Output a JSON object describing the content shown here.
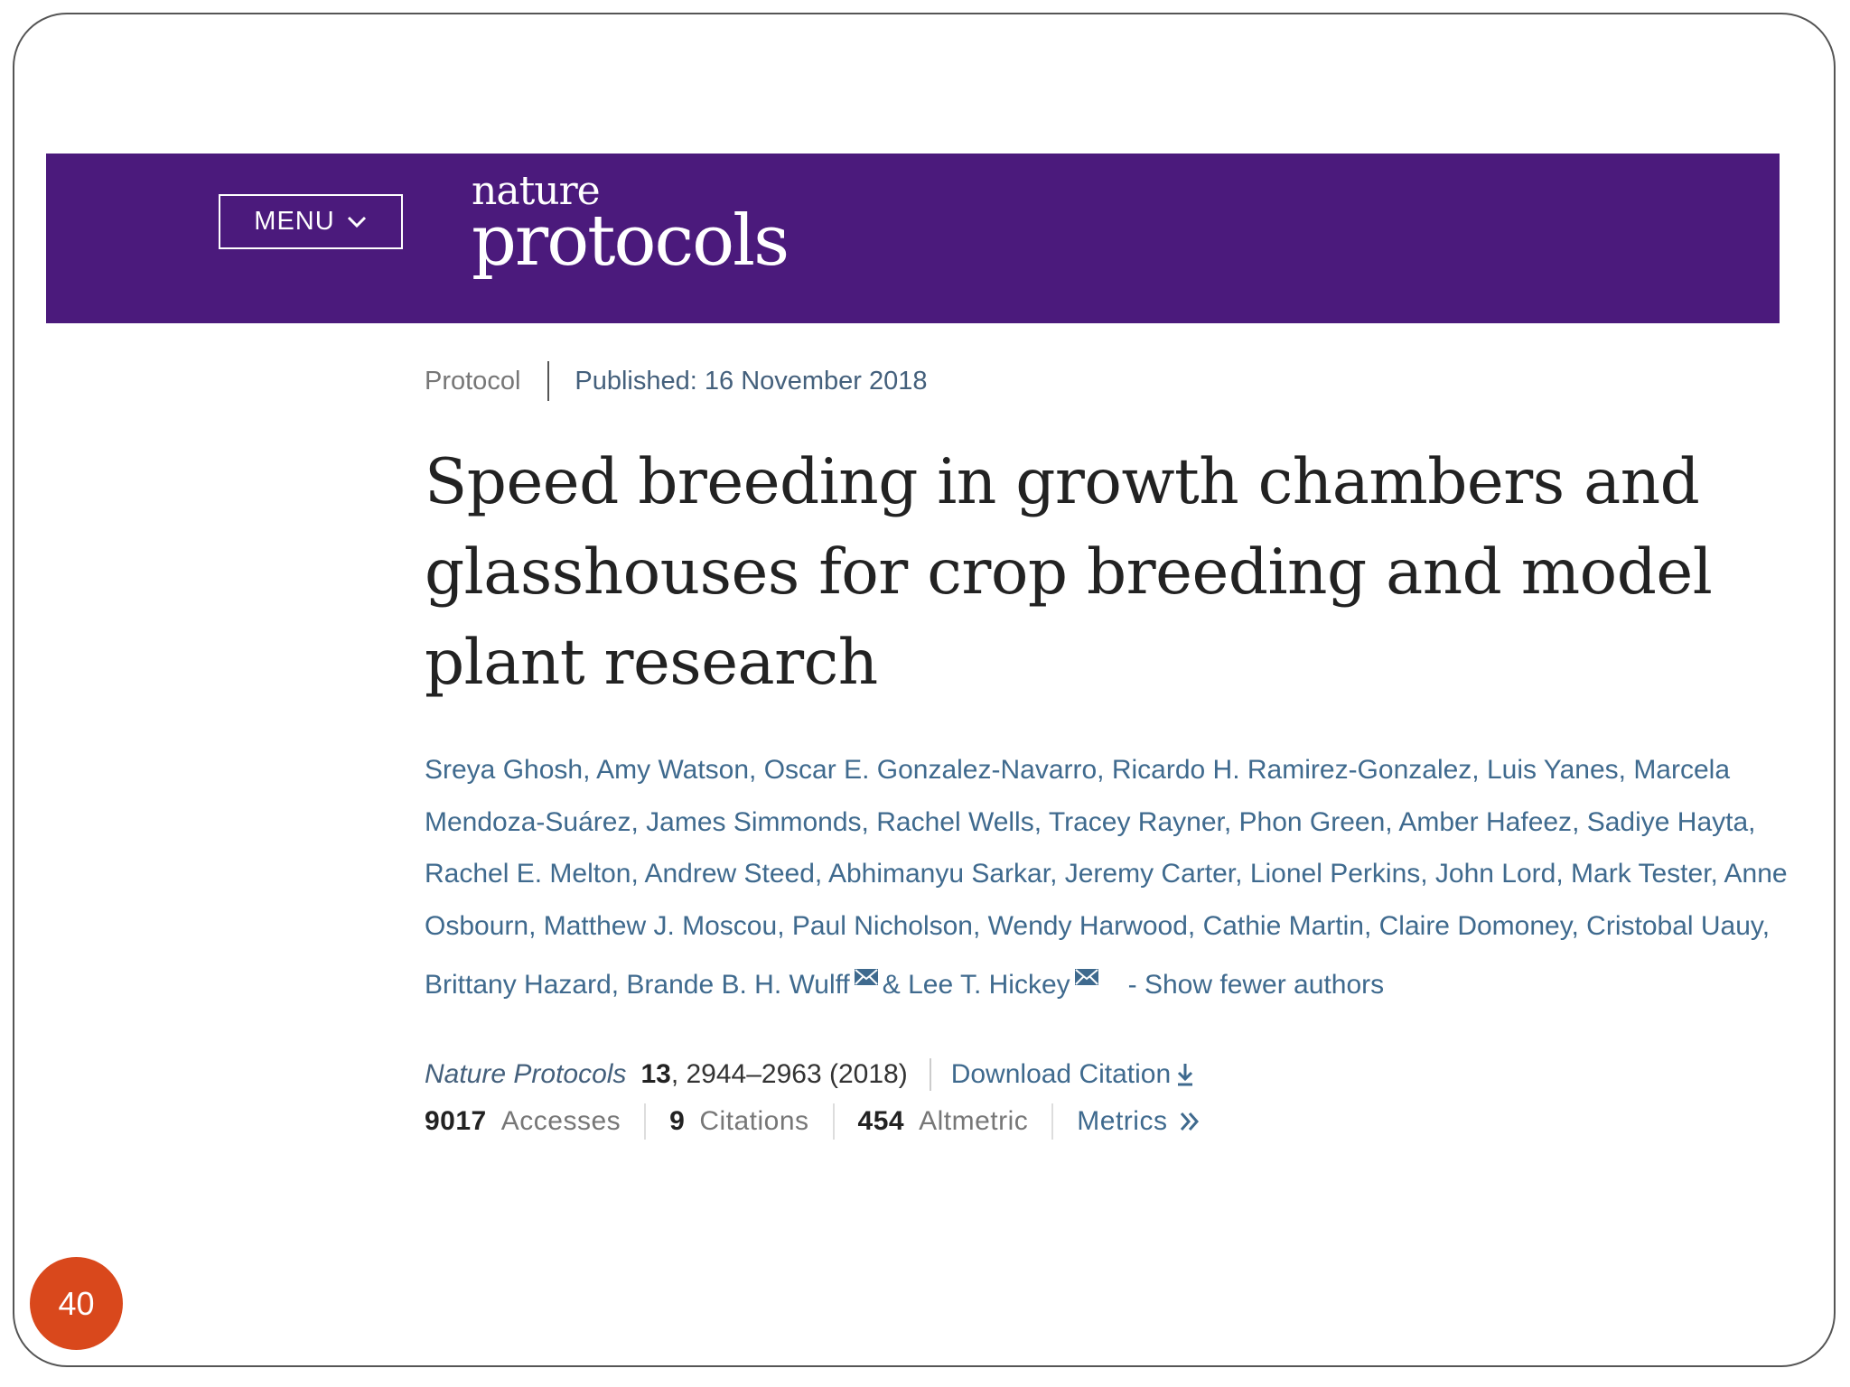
{
  "header": {
    "menu_label": "MENU",
    "logo_top": "nature",
    "logo_bottom": "protocols",
    "brand_color": "#4b1a7c"
  },
  "article": {
    "type": "Protocol",
    "published": "Published: 16 November 2018",
    "title": "Speed breeding in growth chambers and glasshouses for crop breeding and model plant research",
    "authors": [
      "Sreya Ghosh",
      "Amy Watson",
      "Oscar E. Gonzalez-Navarro",
      "Ricardo H. Ramirez-Gonzalez",
      "Luis Yanes",
      "Marcela Mendoza-Suárez",
      "James Simmonds",
      "Rachel Wells",
      "Tracey Rayner",
      "Phon Green",
      "Amber Hafeez",
      "Sadiye Hayta",
      "Rachel E. Melton",
      "Andrew Steed",
      "Abhimanyu Sarkar",
      "Jeremy Carter",
      "Lionel Perkins",
      "John Lord",
      "Mark Tester",
      "Anne Osbourn",
      "Matthew J. Moscou",
      "Paul Nicholson",
      "Wendy Harwood",
      "Cathie Martin",
      "Claire Domoney",
      "Cristobal Uauy",
      "Brittany Hazard",
      "Brande B. H. Wulff",
      "Lee T. Hickey"
    ],
    "author_joiner": "& ",
    "show_fewer_label": "- Show fewer authors",
    "journal": "Nature Protocols",
    "volume": "13",
    "pages_year": ", 2944–2963 (2018)",
    "download_label": "Download Citation",
    "metrics": {
      "accesses_count": "9017",
      "accesses_label": "Accesses",
      "citations_count": "9",
      "citations_label": "Citations",
      "altmetric_count": "454",
      "altmetric_label": "Altmetric",
      "metrics_link": "Metrics"
    }
  },
  "slide": {
    "page_number": "40"
  }
}
